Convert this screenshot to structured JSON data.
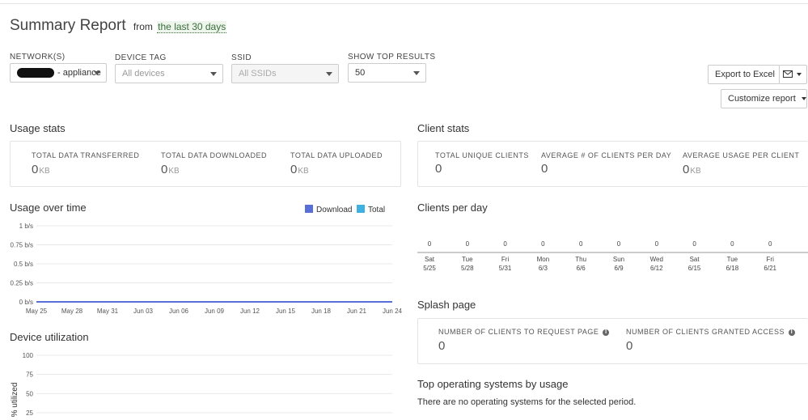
{
  "header": {
    "title": "Summary Report",
    "from_label": "from",
    "range_label": "the last 30 days"
  },
  "filters": {
    "network": {
      "label": "NETWORK(S)",
      "value": "- appliance"
    },
    "device_tag": {
      "label": "DEVICE TAG",
      "placeholder": "All devices"
    },
    "ssid": {
      "label": "SSID",
      "placeholder": "All SSIDs"
    },
    "top_results": {
      "label": "SHOW TOP RESULTS",
      "value": "50"
    }
  },
  "toolbar": {
    "export_label": "Export to Excel",
    "email_icon": "envelope-icon",
    "customize_label": "Customize report"
  },
  "usage_stats": {
    "title": "Usage stats",
    "items": [
      {
        "label": "TOTAL DATA TRANSFERRED",
        "value": "0",
        "unit": "KB"
      },
      {
        "label": "TOTAL DATA DOWNLOADED",
        "value": "0",
        "unit": "KB"
      },
      {
        "label": "TOTAL DATA UPLOADED",
        "value": "0",
        "unit": "KB"
      }
    ]
  },
  "client_stats": {
    "title": "Client stats",
    "items": [
      {
        "label": "TOTAL UNIQUE CLIENTS",
        "value": "0",
        "unit": ""
      },
      {
        "label": "AVERAGE # OF CLIENTS PER DAY",
        "value": "0",
        "unit": ""
      },
      {
        "label": "AVERAGE USAGE PER CLIENT",
        "value": "0",
        "unit": "KB"
      }
    ]
  },
  "usage_over_time": {
    "title": "Usage over time",
    "legend": [
      {
        "name": "Download",
        "color": "#5a6fd6"
      },
      {
        "name": "Total",
        "color": "#3fb0e0"
      }
    ]
  },
  "clients_per_day": {
    "title": "Clients per day"
  },
  "splash_page": {
    "title": "Splash page",
    "items": [
      {
        "label": "NUMBER OF CLIENTS TO REQUEST PAGE",
        "value": "0"
      },
      {
        "label": "NUMBER OF CLIENTS GRANTED ACCESS",
        "value": "0"
      }
    ]
  },
  "device_utilization": {
    "title": "Device utilization"
  },
  "top_os": {
    "title": "Top operating systems by usage",
    "empty_message": "There are no operating systems for the selected period."
  },
  "chart_data": [
    {
      "type": "line",
      "name": "usage-over-time",
      "y_tick_labels": [
        "0 b/s",
        "0.25 b/s",
        "0.5 b/s",
        "0.75 b/s",
        "1 b/s"
      ],
      "y_ticks": [
        0,
        0.25,
        0.5,
        0.75,
        1
      ],
      "ylim": [
        0,
        1
      ],
      "x_tick_labels": [
        "May 25",
        "May 28",
        "May 31",
        "Jun 03",
        "Jun 06",
        "Jun 09",
        "Jun 12",
        "Jun 15",
        "Jun 18",
        "Jun 21",
        "Jun 24"
      ],
      "series": [
        {
          "name": "Download",
          "values": [
            0,
            0,
            0,
            0,
            0,
            0,
            0,
            0,
            0,
            0,
            0
          ]
        },
        {
          "name": "Total",
          "values": [
            0,
            0,
            0,
            0,
            0,
            0,
            0,
            0,
            0,
            0,
            0
          ]
        }
      ],
      "grid": true,
      "legend_position": "top-right"
    },
    {
      "type": "bar",
      "name": "clients-per-day",
      "categories": [
        {
          "day": "Sat",
          "date": "5/25"
        },
        {
          "day": "Tue",
          "date": "5/28"
        },
        {
          "day": "Fri",
          "date": "5/31"
        },
        {
          "day": "Mon",
          "date": "6/3"
        },
        {
          "day": "Thu",
          "date": "6/6"
        },
        {
          "day": "Sun",
          "date": "6/9"
        },
        {
          "day": "Wed",
          "date": "6/12"
        },
        {
          "day": "Sat",
          "date": "6/15"
        },
        {
          "day": "Tue",
          "date": "6/18"
        },
        {
          "day": "Fri",
          "date": "6/21"
        }
      ],
      "values": [
        0,
        0,
        0,
        0,
        0,
        0,
        0,
        0,
        0,
        0
      ]
    },
    {
      "type": "line",
      "name": "device-utilization",
      "ylabel": "% utilized",
      "y_ticks": [
        25,
        50,
        75,
        100
      ],
      "ylim": [
        0,
        100
      ],
      "grid": true
    }
  ]
}
